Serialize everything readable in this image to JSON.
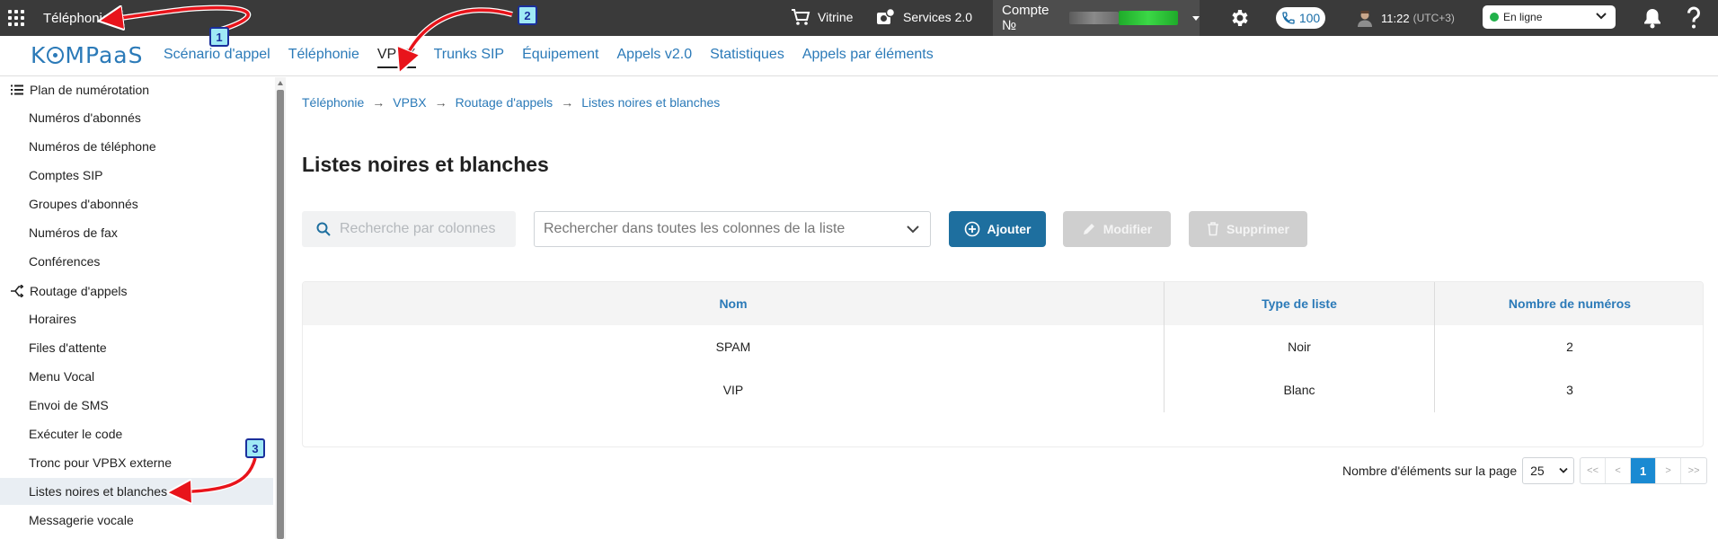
{
  "topbar": {
    "section_title": "Téléphonie",
    "showcase_label": "Vitrine",
    "services_label": "Services 2.0",
    "account_label": "Compte №",
    "phone_count": "100",
    "time_label": "11:22",
    "timezone_label": "(UTC+3)",
    "status_value": "En ligne"
  },
  "nav": {
    "logo_left": "K",
    "logo_mid": "MP",
    "logo_right": "aaS",
    "links": [
      "Scénario d'appel",
      "Téléphonie",
      "VPBX",
      "Trunks SIP",
      "Équipement",
      "Appels v2.0",
      "Statistiques",
      "Appels par éléments"
    ],
    "active": "VPBX"
  },
  "sidebar": {
    "group1": "Plan de numérotation",
    "group1_items": [
      "Numéros d'abonnés",
      "Numéros de téléphone",
      "Comptes SIP",
      "Groupes d'abonnés",
      "Numéros de fax",
      "Conférences"
    ],
    "group2": "Routage d'appels",
    "group2_items": [
      "Horaires",
      "Files d'attente",
      "Menu Vocal",
      "Envoi de SMS",
      "Exécuter le code",
      "Tronc pour VPBX externe",
      "Listes noires et blanches",
      "Messagerie vocale"
    ],
    "selected": "Listes noires et blanches"
  },
  "breadcrumb": [
    "Téléphonie",
    "VPBX",
    "Routage d'appels",
    "Listes noires et blanches"
  ],
  "breadcrumb_sep": "→",
  "page_title": "Listes noires et blanches",
  "toolbar": {
    "search_columns_placeholder": "Recherche par colonnes",
    "search_all_placeholder": "Rechercher dans toutes les colonnes de la liste",
    "add_label": "Ajouter",
    "edit_label": "Modifier",
    "delete_label": "Supprimer"
  },
  "table": {
    "headers": [
      "Nom",
      "Type de liste",
      "Nombre de numéros"
    ],
    "rows": [
      [
        "SPAM",
        "Noir",
        "2"
      ],
      [
        "VIP",
        "Blanc",
        "3"
      ]
    ]
  },
  "pagination": {
    "per_page_label": "Nombre d'éléments sur la page",
    "per_page_value": "25",
    "first": "<<",
    "prev": "<",
    "current": "1",
    "next": ">",
    "last": ">>"
  },
  "annotations": {
    "markers": [
      "1",
      "2",
      "3"
    ],
    "arrow_color": "#e8141b"
  },
  "colors": {
    "topbar_bg": "#3a3a3a",
    "link_blue": "#2b7ab8",
    "primary_button": "#1e6f9f",
    "disabled_button": "#cfcfcf",
    "pager_active": "#1a8ad2",
    "online_green": "#21b14a"
  }
}
